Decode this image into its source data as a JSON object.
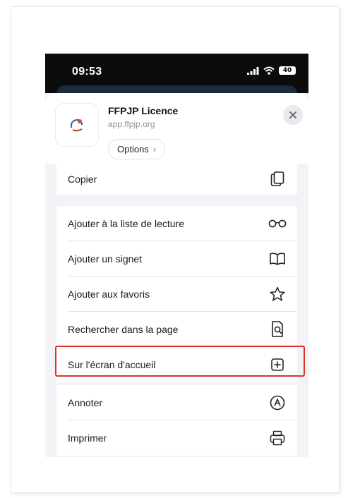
{
  "status_bar": {
    "time": "09:53",
    "battery": "40"
  },
  "share_sheet": {
    "app_name": "FFPJP Licence",
    "app_url": "app.ffpjp.org",
    "options_label": "Options",
    "options_chevron": "›",
    "close_icon": "close-icon"
  },
  "actions": [
    {
      "label": "Copier",
      "icon": "copy-icon"
    },
    {
      "label": "Ajouter à la liste de lecture",
      "icon": "glasses-icon"
    },
    {
      "label": "Ajouter un signet",
      "icon": "book-icon"
    },
    {
      "label": "Ajouter aux favoris",
      "icon": "star-icon"
    },
    {
      "label": "Rechercher dans la page",
      "icon": "find-in-page-icon"
    },
    {
      "label": "Sur l'écran d'accueil",
      "icon": "add-square-icon",
      "highlighted": true
    },
    {
      "label": "Annoter",
      "icon": "markup-icon"
    },
    {
      "label": "Imprimer",
      "icon": "printer-icon"
    }
  ],
  "colors": {
    "highlight": "#e0302b",
    "sheet_background": "#f2f2f7",
    "url_text": "#8a9a8a"
  }
}
